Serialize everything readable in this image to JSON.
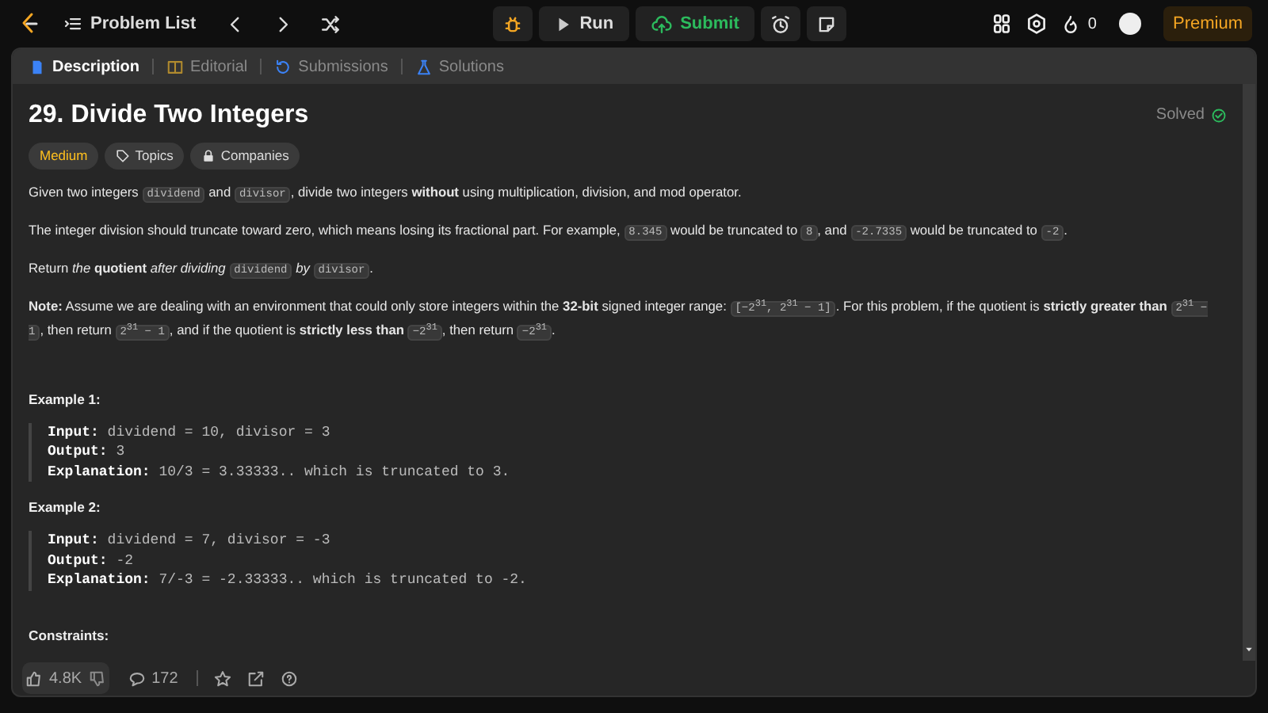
{
  "topbar": {
    "problem_list": "Problem List",
    "run": "Run",
    "submit": "Submit",
    "streak": "0",
    "premium": "Premium"
  },
  "tabs": [
    {
      "label": "Description",
      "selected": true
    },
    {
      "label": "Editorial",
      "selected": false
    },
    {
      "label": "Submissions",
      "selected": false
    },
    {
      "label": "Solutions",
      "selected": false
    }
  ],
  "problem": {
    "title": "29. Divide Two Integers",
    "status": "Solved",
    "difficulty": "Medium",
    "tags": [
      "Topics",
      "Companies"
    ]
  },
  "paragraphs": [
    [
      {
        "kind": "text",
        "text": "Given two integers "
      },
      {
        "kind": "code",
        "text": "dividend"
      },
      {
        "kind": "text",
        "text": " and "
      },
      {
        "kind": "code",
        "text": "divisor"
      },
      {
        "kind": "text",
        "text": ", divide two integers **without** using multiplication, division, and mod operator."
      }
    ],
    [
      {
        "kind": "text",
        "text": "The integer division should truncate toward zero, which means losing its fractional part. For example, "
      },
      {
        "kind": "code",
        "text": "8.345"
      },
      {
        "kind": "text",
        "text": " would be truncated to "
      },
      {
        "kind": "code",
        "text": "8"
      },
      {
        "kind": "text",
        "text": ", and "
      },
      {
        "kind": "code",
        "text": "-2.7335"
      },
      {
        "kind": "text",
        "text": " would be truncated to "
      },
      {
        "kind": "code",
        "text": "-2"
      },
      {
        "kind": "text",
        "text": "."
      }
    ],
    [
      {
        "kind": "text",
        "text": "Return *the* **quotient** *after dividing* "
      },
      {
        "kind": "code",
        "text": "dividend"
      },
      {
        "kind": "text",
        "text": " *by* "
      },
      {
        "kind": "code",
        "text": "divisor"
      },
      {
        "kind": "text",
        "text": "."
      }
    ],
    [
      {
        "kind": "text",
        "text": "**Note:** Assume we are dealing with an environment that could only store integers within the **32-bit** signed integer range: "
      },
      {
        "kind": "code",
        "text": "[−2$^{31}$, 2$^{31}$ − 1]"
      },
      {
        "kind": "text",
        "text": ". For this problem, if the quotient is **strictly greater than** "
      },
      {
        "kind": "code",
        "text": "2$^{31}$ − 1"
      },
      {
        "kind": "text",
        "text": ", then return "
      },
      {
        "kind": "code",
        "text": "2$^{31}$ − 1"
      },
      {
        "kind": "text",
        "text": ", and if the quotient is **strictly less than** "
      },
      {
        "kind": "code",
        "text": "−2$^{31}$"
      },
      {
        "kind": "text",
        "text": ", then return "
      },
      {
        "kind": "code",
        "text": "−2$^{31}$"
      },
      {
        "kind": "text",
        "text": "."
      }
    ]
  ],
  "examples": [
    {
      "title": "Example 1:",
      "lines": [
        {
          "label": "Input:",
          "value": "dividend = 10, divisor = 3"
        },
        {
          "label": "Output:",
          "value": "3"
        },
        {
          "label": "Explanation:",
          "value": "10/3 = 3.33333.. which is truncated to 3."
        }
      ]
    },
    {
      "title": "Example 2:",
      "lines": [
        {
          "label": "Input:",
          "value": "dividend = 7, divisor = -3"
        },
        {
          "label": "Output:",
          "value": "-2"
        },
        {
          "label": "Explanation:",
          "value": "7/-3 = -2.33333.. which is truncated to -2."
        }
      ]
    }
  ],
  "constraints_heading": "Constraints:",
  "footer": {
    "likes": "4.8K",
    "comments": "172"
  }
}
